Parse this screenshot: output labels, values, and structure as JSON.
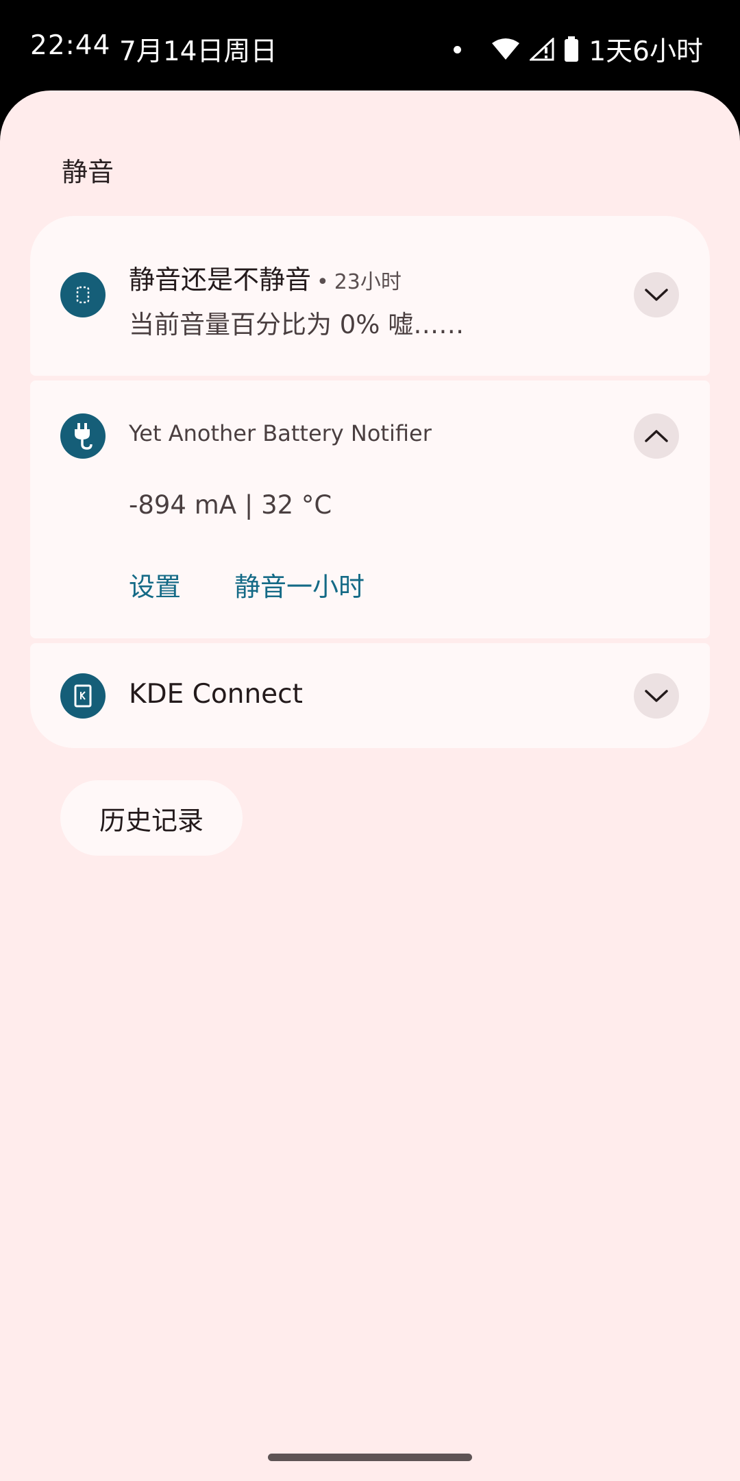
{
  "status_bar": {
    "time": "22:44",
    "date": "7月14日周日",
    "battery_text": "1天6小时",
    "icons": [
      "notification-dot-icon",
      "wifi-icon",
      "cellular-no-signal-icon",
      "battery-icon"
    ]
  },
  "shade": {
    "section_title": "静音",
    "history_button": "历史记录"
  },
  "notifications": [
    {
      "app_icon": "app-square-icon",
      "title": "静音还是不静音",
      "separator": "•",
      "time": "23小时",
      "text": "当前音量百分比为 0%  嘘……",
      "expand_icon": "chevron-down-icon"
    },
    {
      "app_icon": "plug-icon",
      "app_name": "Yet Another Battery Notifier",
      "text": "-894 mA | 32 °C",
      "actions": [
        "设置",
        "静音一小时"
      ],
      "expand_icon": "chevron-up-icon"
    },
    {
      "app_icon": "kde-connect-icon",
      "title": "KDE Connect",
      "expand_icon": "chevron-down-icon"
    }
  ],
  "colors": {
    "shade_background": "#ffecec",
    "card_background": "#fff8f8",
    "accent": "#146a86",
    "icon_background": "#155e78"
  }
}
